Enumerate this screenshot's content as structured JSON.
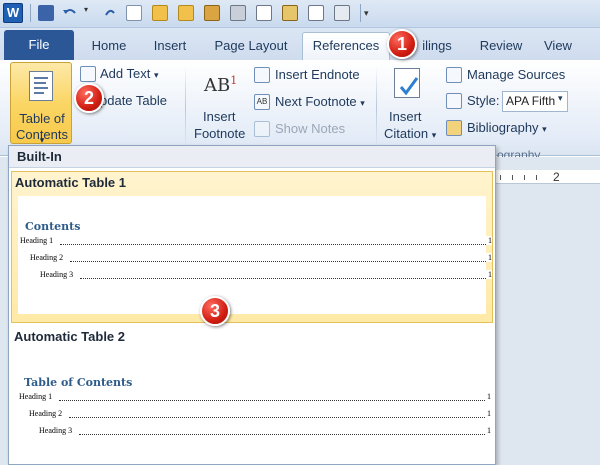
{
  "qat": {
    "app_icon_label": "W",
    "icons": [
      "save-icon",
      "undo-icon",
      "redo-icon",
      "new-icon",
      "open-icon",
      "folder-icon",
      "print-icon",
      "print-preview-icon",
      "paste-icon",
      "format-icon",
      "customize-icon"
    ]
  },
  "tabs": {
    "file": "File",
    "items": [
      "Home",
      "Insert",
      "Page Layout",
      "References",
      "ilings",
      "Review",
      "View"
    ],
    "active": "References"
  },
  "ribbon": {
    "toc": {
      "line1": "Table of",
      "line2": "Contents",
      "arrow": "▾"
    },
    "add_text": "Add Text",
    "update_table": "pdate Table",
    "insert_footnote": {
      "line1": "Insert",
      "line2": "Footnote",
      "icon_text": "AB",
      "icon_sup": "1"
    },
    "insert_endnote": "Insert Endnote",
    "next_footnote": "Next Footnote",
    "show_notes": "Show Notes",
    "insert_citation": {
      "line1": "Insert",
      "line2": "Citation"
    },
    "manage_sources": "Manage Sources",
    "style_label": "Style:",
    "style_value": "APA Fifth",
    "bibliography": "Bibliography",
    "group_label_citations": "ography"
  },
  "ruler": {
    "number": "2"
  },
  "gallery": {
    "header": "Built-In",
    "items": [
      {
        "title": "Automatic Table 1",
        "heading": "Contents",
        "rows": [
          {
            "text": "Heading 1",
            "page": "1"
          },
          {
            "text": "Heading 2",
            "page": "1"
          },
          {
            "text": "Heading 3",
            "page": "1"
          }
        ]
      },
      {
        "title": "Automatic Table 2",
        "heading": "Table of Contents",
        "rows": [
          {
            "text": "Heading 1",
            "page": "1"
          },
          {
            "text": "Heading 2",
            "page": "1"
          },
          {
            "text": "Heading 3",
            "page": "1"
          }
        ]
      }
    ]
  },
  "callouts": [
    "1",
    "2",
    "3"
  ],
  "colors": {
    "accent_file_tab": "#2b5797",
    "highlight": "#ffe9a6",
    "callout": "#d11e12",
    "toc_heading": "#2e5c8a"
  }
}
